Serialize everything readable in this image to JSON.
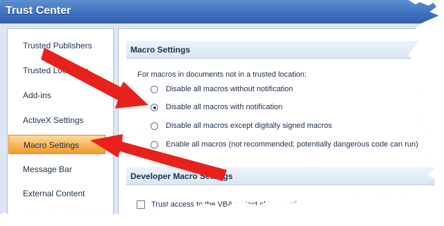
{
  "window": {
    "title": "Trust Center"
  },
  "sidebar": {
    "items": [
      {
        "label": "Trusted Publishers",
        "selected": false
      },
      {
        "label": "Trusted Locations",
        "selected": false
      },
      {
        "label": "Add-ins",
        "selected": false
      },
      {
        "label": "ActiveX Settings",
        "selected": false
      },
      {
        "label": "Macro Settings",
        "selected": true
      },
      {
        "label": "Message Bar",
        "selected": false
      },
      {
        "label": "External Content",
        "selected": false
      }
    ]
  },
  "macro_settings": {
    "header": "Macro Settings",
    "intro": "For macros in documents not in a trusted location:",
    "options": [
      {
        "label": "Disable all macros without notification",
        "selected": false
      },
      {
        "label": "Disable all macros with notification",
        "selected": true
      },
      {
        "label": "Disable all macros except digitally signed macros",
        "selected": false
      },
      {
        "label": "Enable all macros (not recommended; potentially dangerous code can run)",
        "selected": false
      }
    ]
  },
  "developer_settings": {
    "header": "Developer Macro Settings",
    "checkbox_label": "Trust access to the VBA project object model",
    "checked": false
  },
  "annotations": {
    "arrow_color": "#e8211d"
  }
}
